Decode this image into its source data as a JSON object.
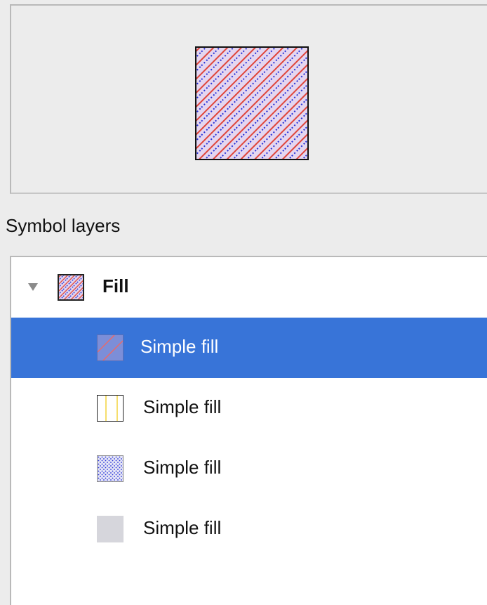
{
  "preview": {
    "swatch_icon": "hatched-fill-preview-icon"
  },
  "symbol_layers": {
    "title": "Symbol layers",
    "root": {
      "label": "Fill",
      "icon": "hatched-fill-icon",
      "expanded": true
    },
    "items": [
      {
        "label": "Simple fill",
        "icon": "diagonal-line-fill-icon",
        "selected": true
      },
      {
        "label": "Simple fill",
        "icon": "vertical-line-fill-icon",
        "selected": false
      },
      {
        "label": "Simple fill",
        "icon": "dot-fill-icon",
        "selected": false
      },
      {
        "label": "Simple fill",
        "icon": "gray-solid-fill-icon",
        "selected": false
      }
    ]
  },
  "colors": {
    "selection": "#3874d8",
    "hatch_red": "#e0453a",
    "hatch_blue": "#2430d8",
    "hatch_yellow": "#f2d23a",
    "fill_gray": "#d6d6dc"
  }
}
